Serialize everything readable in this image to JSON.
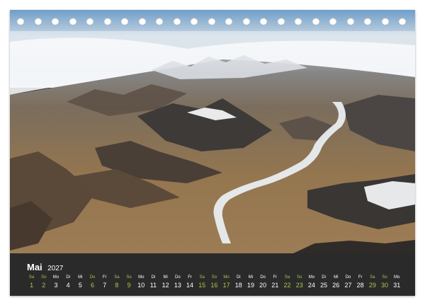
{
  "calendar": {
    "month": "Mai",
    "year": "2027",
    "days": [
      {
        "dow": "Sa",
        "num": "1",
        "weekend": true
      },
      {
        "dow": "So",
        "num": "2",
        "weekend": true
      },
      {
        "dow": "Mo",
        "num": "3",
        "weekend": false
      },
      {
        "dow": "Di",
        "num": "4",
        "weekend": false
      },
      {
        "dow": "Mi",
        "num": "5",
        "weekend": false
      },
      {
        "dow": "Do",
        "num": "6",
        "weekend": true
      },
      {
        "dow": "Fr",
        "num": "7",
        "weekend": false
      },
      {
        "dow": "Sa",
        "num": "8",
        "weekend": true
      },
      {
        "dow": "So",
        "num": "9",
        "weekend": true
      },
      {
        "dow": "Mo",
        "num": "10",
        "weekend": false
      },
      {
        "dow": "Di",
        "num": "11",
        "weekend": false
      },
      {
        "dow": "Mi",
        "num": "12",
        "weekend": false
      },
      {
        "dow": "Do",
        "num": "13",
        "weekend": false
      },
      {
        "dow": "Fr",
        "num": "14",
        "weekend": false
      },
      {
        "dow": "Sa",
        "num": "15",
        "weekend": true
      },
      {
        "dow": "So",
        "num": "16",
        "weekend": true
      },
      {
        "dow": "Mo",
        "num": "17",
        "weekend": true
      },
      {
        "dow": "Di",
        "num": "18",
        "weekend": false
      },
      {
        "dow": "Mi",
        "num": "19",
        "weekend": false
      },
      {
        "dow": "Do",
        "num": "20",
        "weekend": false
      },
      {
        "dow": "Fr",
        "num": "21",
        "weekend": false
      },
      {
        "dow": "Sa",
        "num": "22",
        "weekend": true
      },
      {
        "dow": "So",
        "num": "23",
        "weekend": true
      },
      {
        "dow": "Mo",
        "num": "24",
        "weekend": false
      },
      {
        "dow": "Di",
        "num": "25",
        "weekend": false
      },
      {
        "dow": "Mi",
        "num": "26",
        "weekend": false
      },
      {
        "dow": "Do",
        "num": "27",
        "weekend": false
      },
      {
        "dow": "Fr",
        "num": "28",
        "weekend": false
      },
      {
        "dow": "Sa",
        "num": "29",
        "weekend": true
      },
      {
        "dow": "So",
        "num": "30",
        "weekend": true
      },
      {
        "dow": "Mo",
        "num": "31",
        "weekend": false
      }
    ]
  },
  "colors": {
    "weekday": "#ffffff",
    "weekend": "#a8c64a",
    "strip_background": "#2a2a2a"
  }
}
